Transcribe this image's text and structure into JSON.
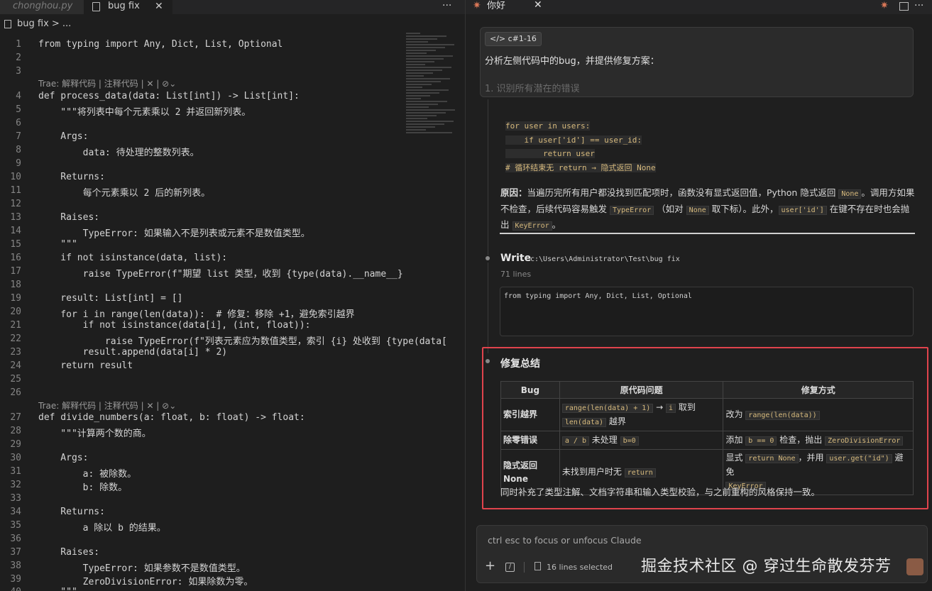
{
  "editor": {
    "tabs": [
      {
        "label": "chonghou.py"
      },
      {
        "label": "bug fix",
        "close": "✕"
      }
    ],
    "more": "···",
    "breadcrumb": "bug fix > ...",
    "lens": "Trae: 解释代码 | 注释代码 | ✕ | ⊘⌄",
    "lines": [
      {
        "n": "1",
        "code": "from typing import Any, Dict, List, Optional"
      },
      {
        "n": "2",
        "code": ""
      },
      {
        "n": "3",
        "code": ""
      },
      {
        "n": "4",
        "code": "def process_data(data: List[int]) -> List[int]:"
      },
      {
        "n": "5",
        "code": "    \"\"\"将列表中每个元素乘以 2 并返回新列表。"
      },
      {
        "n": "6",
        "code": ""
      },
      {
        "n": "7",
        "code": "    Args:"
      },
      {
        "n": "8",
        "code": "        data: 待处理的整数列表。"
      },
      {
        "n": "9",
        "code": ""
      },
      {
        "n": "10",
        "code": "    Returns:"
      },
      {
        "n": "11",
        "code": "        每个元素乘以 2 后的新列表。"
      },
      {
        "n": "12",
        "code": ""
      },
      {
        "n": "13",
        "code": "    Raises:"
      },
      {
        "n": "14",
        "code": "        TypeError: 如果输入不是列表或元素不是数值类型。"
      },
      {
        "n": "15",
        "code": "    \"\"\""
      },
      {
        "n": "16",
        "code": "    if not isinstance(data, list):"
      },
      {
        "n": "17",
        "code": "        raise TypeError(f\"期望 list 类型，收到 {type(data).__name__}"
      },
      {
        "n": "18",
        "code": ""
      },
      {
        "n": "19",
        "code": "    result: List[int] = []"
      },
      {
        "n": "20",
        "code": "    for i in range(len(data)):  # 修复：移除 +1，避免索引越界"
      },
      {
        "n": "21",
        "code": "        if not isinstance(data[i], (int, float)):"
      },
      {
        "n": "22",
        "code": "            raise TypeError(f\"列表元素应为数值类型，索引 {i} 处收到 {type(data["
      },
      {
        "n": "23",
        "code": "        result.append(data[i] * 2)"
      },
      {
        "n": "24",
        "code": "    return result"
      },
      {
        "n": "25",
        "code": ""
      },
      {
        "n": "26",
        "code": ""
      },
      {
        "n": "27",
        "code": "def divide_numbers(a: float, b: float) -> float:"
      },
      {
        "n": "28",
        "code": "    \"\"\"计算两个数的商。"
      },
      {
        "n": "29",
        "code": ""
      },
      {
        "n": "30",
        "code": "    Args:"
      },
      {
        "n": "31",
        "code": "        a: 被除数。"
      },
      {
        "n": "32",
        "code": "        b: 除数。"
      },
      {
        "n": "33",
        "code": ""
      },
      {
        "n": "34",
        "code": "    Returns:"
      },
      {
        "n": "35",
        "code": "        a 除以 b 的结果。"
      },
      {
        "n": "36",
        "code": ""
      },
      {
        "n": "37",
        "code": "    Raises:"
      },
      {
        "n": "38",
        "code": "        TypeError: 如果参数不是数值类型。"
      },
      {
        "n": "39",
        "code": "        ZeroDivisionError: 如果除数为零。"
      },
      {
        "n": "40",
        "code": "    \"\"\""
      }
    ]
  },
  "panel": {
    "tab_title": "你好",
    "tab_close": "✕",
    "star": "✷",
    "more": "···",
    "chip": "</> c#1-16",
    "prompt": "分析左侧代码中的bug，并提供修复方案：",
    "prompt_faded": "1. 识别所有潜在的错误",
    "code_lines": [
      "for user in users:",
      "    if user['id'] == user_id:",
      "        return user",
      "# 循环结束无 return → 隐式返回 None"
    ],
    "cause_label": "原因：",
    "cause_1": "当遍历完所有用户都没找到匹配项时，函数没有显式返回值，Python 隐式返回",
    "cause_none": "None",
    "cause_2": "。调用方如果不检查，后续代码容易触发",
    "cause_typeerror": "TypeError",
    "cause_3": "（如对",
    "cause_none2": "None",
    "cause_4": "取下标）。此外，",
    "cause_userid": "user['id']",
    "cause_5": "在键不存在时也会抛出",
    "cause_keyerror": "KeyError",
    "cause_6": "。",
    "write_label": "Write",
    "write_path": "c:\\Users\\Administrator\\Test\\bug fix",
    "write_lines": "71 lines",
    "write_code": "from typing import Any, Dict, List, Optional",
    "summary_title": "修复总结",
    "table": {
      "headers": [
        "Bug",
        "原代码问题",
        "修复方式"
      ],
      "row1": {
        "bug": "索引越界",
        "p1": "range(len(data) + 1)",
        "p2": "→",
        "p3": "i",
        "p4": "取到",
        "p5": "len(data)",
        "p6": "越界",
        "f1": "改为",
        "f2": "range(len(data))"
      },
      "row2": {
        "bug": "除零错误",
        "p1": "a / b",
        "p2": "未处理",
        "p3": "b=0",
        "f1": "添加",
        "f2": "b == 0",
        "f3": "检查，抛出",
        "f4": "ZeroDivisionError"
      },
      "row3": {
        "bug": "隐式返回 None",
        "p1": "未找到用户时无",
        "p2": "return",
        "f1": "显式",
        "f2": "return None",
        "f3": "，并用",
        "f4": "user.get(\"id\")",
        "f5": "避免",
        "f6": "KeyError"
      }
    },
    "after": "同时补充了类型注解、文档字符串和输入类型校验，与之前重构的风格保持一致。",
    "input_placeholder": "ctrl esc to focus or unfocus Claude",
    "plus": "+",
    "slash": "/",
    "selected": "16 lines selected"
  },
  "watermark": "掘金技术社区 @ 穿过生命散发芬芳"
}
